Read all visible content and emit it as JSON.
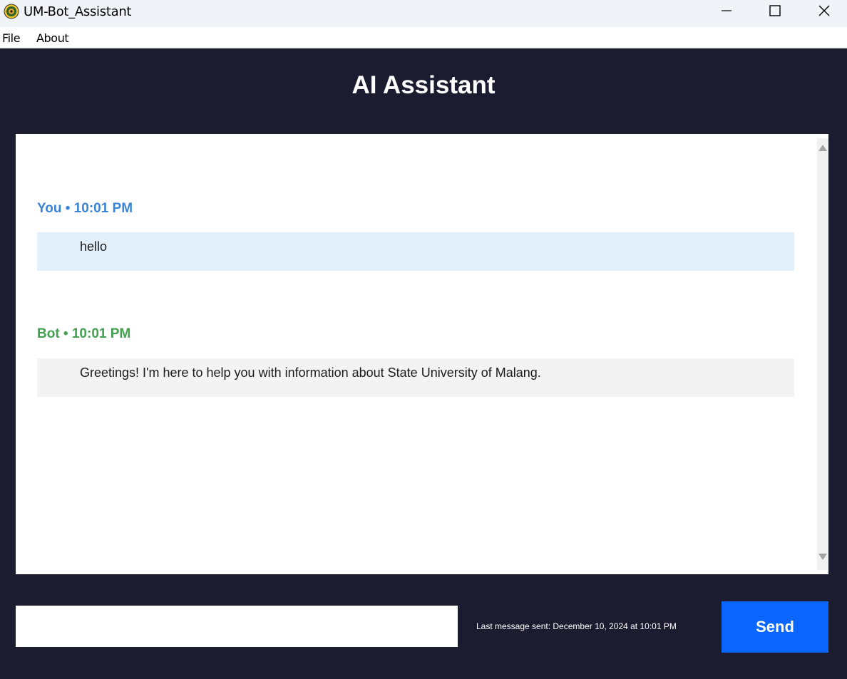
{
  "window": {
    "title": "UM-Bot_Assistant",
    "icon": "university-seal-icon",
    "controls": [
      "minimize-icon",
      "maximize-icon",
      "close-icon"
    ]
  },
  "menu": {
    "file": "File",
    "about": "About"
  },
  "header": {
    "title": "AI Assistant"
  },
  "chat": {
    "messages": [
      {
        "sender": "You",
        "time": "10:01 PM",
        "header": "You • 10:01 PM",
        "text": "hello"
      },
      {
        "sender": "Bot",
        "time": "10:01 PM",
        "header": "Bot • 10:01 PM",
        "text": "Greetings! I'm here to help you with information about State University of Malang."
      }
    ]
  },
  "input": {
    "value": "",
    "placeholder": ""
  },
  "status": {
    "last_sent": "Last message sent: December 10, 2024 at 10:01 PM"
  },
  "send": {
    "label": "Send"
  },
  "colors": {
    "background": "#1b1c30",
    "user_accent": "#3a84d8",
    "bot_accent": "#43a14f",
    "user_bubble": "#e2f0fc",
    "bot_bubble": "#f3f3f3",
    "send_button": "#0b66ff"
  }
}
